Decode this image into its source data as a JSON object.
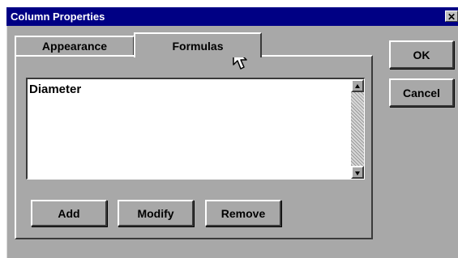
{
  "window": {
    "title": "Column Properties",
    "close_glyph": "✕"
  },
  "tabs": [
    {
      "label": "Appearance",
      "selected": false
    },
    {
      "label": "Formulas",
      "selected": true
    }
  ],
  "formulas_list": {
    "items": [
      "Diameter"
    ]
  },
  "buttons": {
    "add": "Add",
    "modify": "Modify",
    "remove": "Remove",
    "ok": "OK",
    "cancel": "Cancel"
  },
  "icons": {
    "cursor": "mouse-pointer-icon",
    "scroll_up": "scroll-up-arrow-icon",
    "scroll_down": "scroll-down-arrow-icon",
    "close": "close-icon"
  },
  "colors": {
    "titlebar": "#000084",
    "dialog_face": "#a8a8a8",
    "listbox_bg": "#ffffff"
  }
}
